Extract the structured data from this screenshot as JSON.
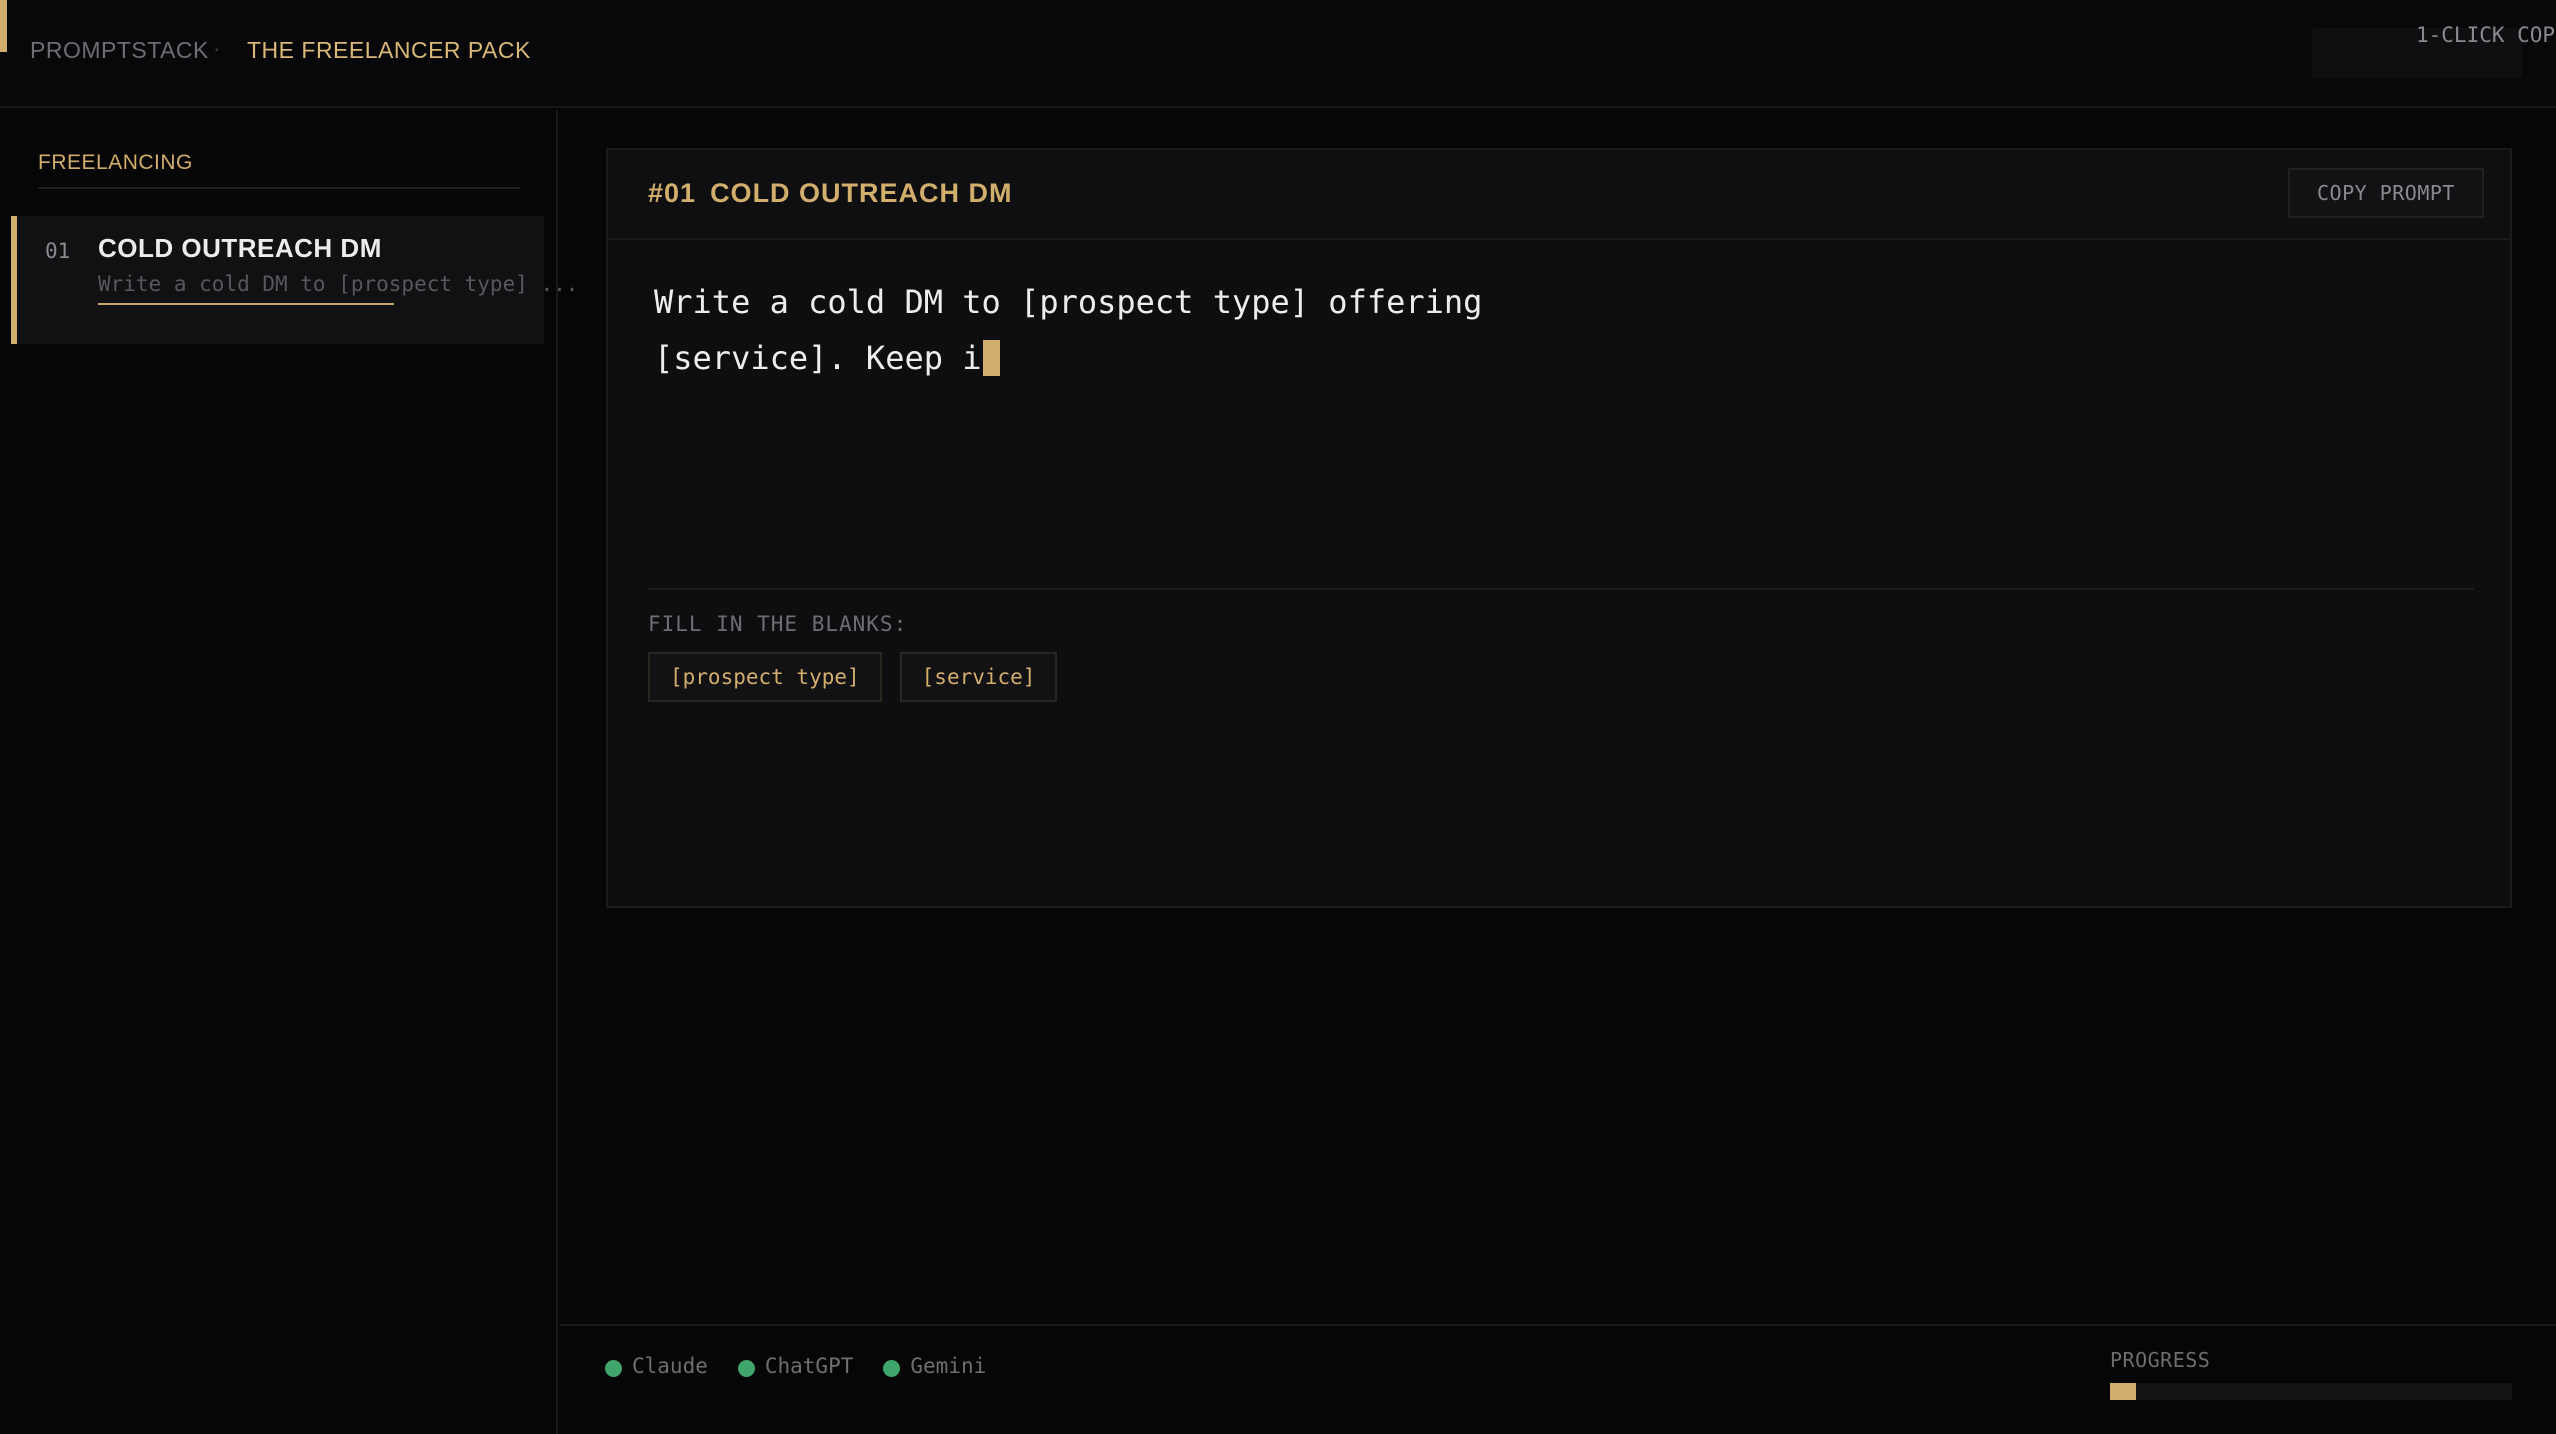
{
  "header": {
    "breadcrumb_root": "PROMPTSTACK",
    "breadcrumb_separator": "·",
    "breadcrumb_current": "THE FREELANCER PACK",
    "top_right_label": "1-CLICK COP"
  },
  "sidebar": {
    "heading": "FREELANCING",
    "items": [
      {
        "number": "01",
        "title": "COLD OUTREACH DM",
        "preview": "Write a cold DM to [prospect type] ..."
      }
    ]
  },
  "card": {
    "number": "#01",
    "title": "COLD OUTREACH DM",
    "copy_label": "COPY PROMPT",
    "prompt_text": "Write a cold DM to [prospect type] offering\n[service]. Keep i",
    "fill_label": "FILL IN THE BLANKS:",
    "blanks": [
      "[prospect type]",
      "[service]"
    ]
  },
  "footer": {
    "models": [
      {
        "name": "Claude",
        "status_color": "#3fa56a"
      },
      {
        "name": "ChatGPT",
        "status_color": "#3fa56a"
      },
      {
        "name": "Gemini",
        "status_color": "#3fa56a"
      }
    ],
    "progress_label": "PROGRESS",
    "progress_fraction": 0.065
  },
  "colors": {
    "accent": "#d2ae6d",
    "status_green": "#3fa56a",
    "background": "#060607"
  }
}
